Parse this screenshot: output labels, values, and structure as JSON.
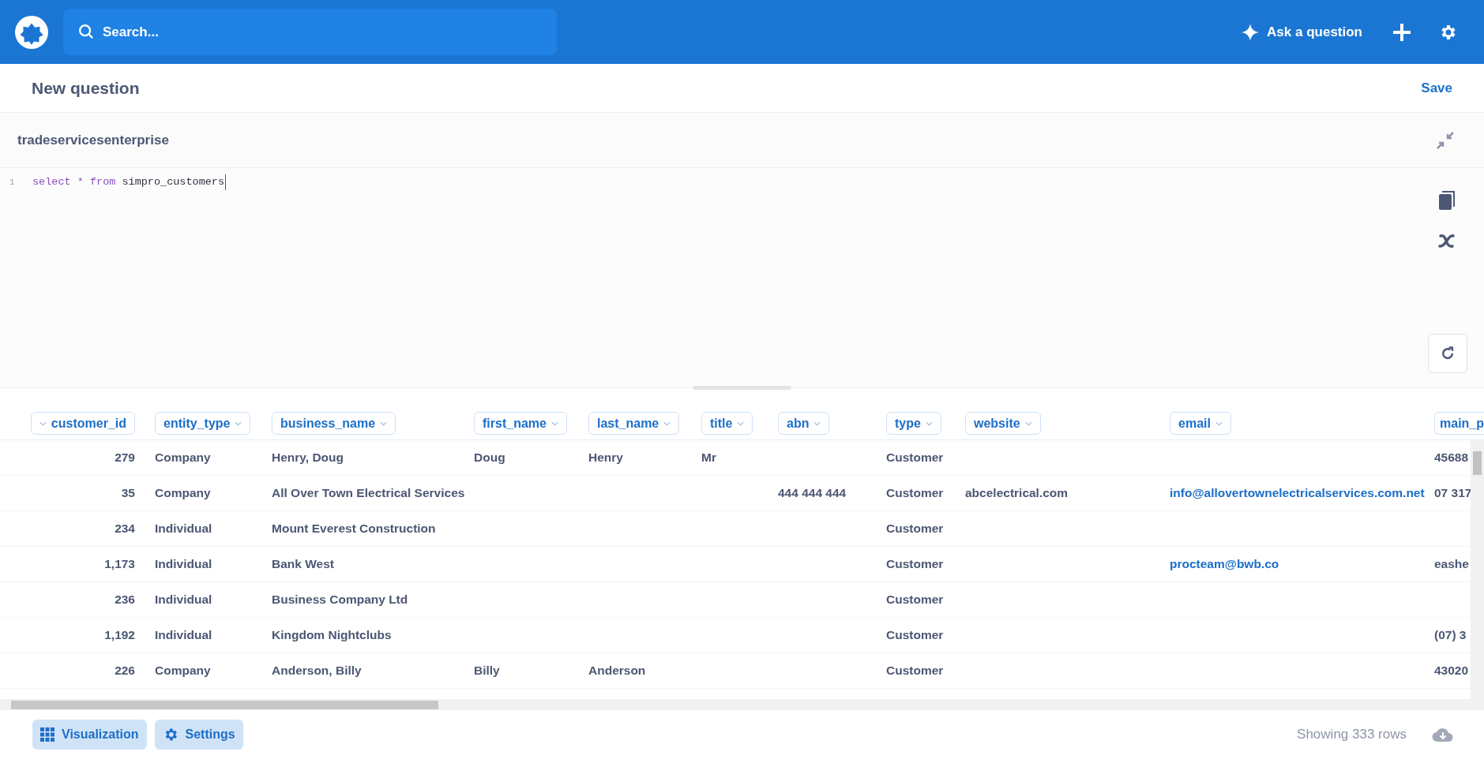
{
  "top_bar": {
    "search": {
      "placeholder": "Search..."
    },
    "ask_button": "Ask a question"
  },
  "question": {
    "title": "New question",
    "save": "Save"
  },
  "database": {
    "name": "tradeservicesenterprise"
  },
  "editor": {
    "lines": [
      {
        "number": "1",
        "tokens": [
          {
            "kind": "keyword",
            "text": "select"
          },
          {
            "kind": "keyword",
            "text": "*"
          },
          {
            "kind": "keyword",
            "text": "from"
          },
          {
            "kind": "plain",
            "text": "simpro_customers"
          }
        ]
      }
    ]
  },
  "table": {
    "columns": [
      {
        "name": "customer_id",
        "kind": "number"
      },
      {
        "name": "entity_type",
        "kind": "text"
      },
      {
        "name": "business_name",
        "kind": "text"
      },
      {
        "name": "first_name",
        "kind": "text"
      },
      {
        "name": "last_name",
        "kind": "text"
      },
      {
        "name": "title",
        "kind": "text"
      },
      {
        "name": "abn",
        "kind": "text"
      },
      {
        "name": "type",
        "kind": "text"
      },
      {
        "name": "website",
        "kind": "text"
      },
      {
        "name": "email",
        "kind": "link"
      },
      {
        "name": "main_p",
        "kind": "text"
      }
    ],
    "rows": [
      [
        "279",
        "Company",
        "Henry, Doug",
        "Doug",
        "Henry",
        "Mr",
        "",
        "Customer",
        "",
        "",
        "45688"
      ],
      [
        "35",
        "Company",
        "All Over Town Electrical Services",
        "",
        "",
        "",
        "444 444 444",
        "Customer",
        "abcelectrical.com",
        "info@allovertownelectricalservices.com.net",
        "07 317"
      ],
      [
        "234",
        "Individual",
        "Mount Everest Construction",
        "",
        "",
        "",
        "",
        "Customer",
        "",
        "",
        ""
      ],
      [
        "1,173",
        "Individual",
        "Bank West",
        "",
        "",
        "",
        "",
        "Customer",
        "",
        "procteam@bwb.co",
        "eashe"
      ],
      [
        "236",
        "Individual",
        "Business Company Ltd",
        "",
        "",
        "",
        "",
        "Customer",
        "",
        "",
        ""
      ],
      [
        "1,192",
        "Individual",
        "Kingdom Nightclubs",
        "",
        "",
        "",
        "",
        "Customer",
        "",
        "",
        "(07) 3"
      ],
      [
        "226",
        "Company",
        "Anderson, Billy",
        "Billy",
        "Anderson",
        "",
        "",
        "Customer",
        "",
        "",
        "43020"
      ]
    ]
  },
  "footer": {
    "buttons": [
      {
        "kind": "grid",
        "label": "Visualization"
      },
      {
        "kind": "gear",
        "label": "Settings"
      }
    ],
    "row_count": "Showing 333 rows"
  }
}
